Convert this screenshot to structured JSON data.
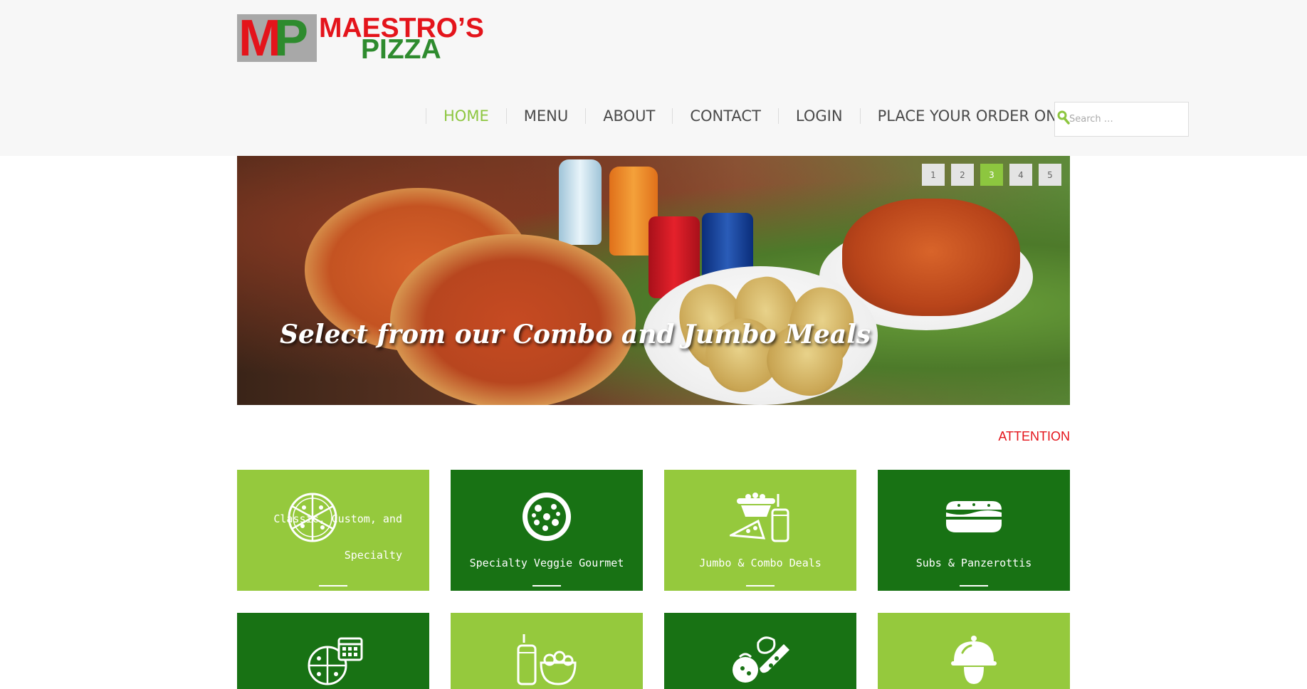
{
  "brand": {
    "logo_mark_m": "M",
    "logo_mark_p": "P",
    "logo_line1": "MAESTRO’S",
    "logo_line2": "PIZZA",
    "red": "#e4141b",
    "green": "#2e8b2e"
  },
  "nav": {
    "items": [
      {
        "label": "HOME",
        "active": true
      },
      {
        "label": "MENU",
        "active": false
      },
      {
        "label": "ABOUT",
        "active": false
      },
      {
        "label": "CONTACT",
        "active": false
      },
      {
        "label": "LOGIN",
        "active": false
      },
      {
        "label": "PLACE YOUR ORDER ONLINE",
        "active": false
      }
    ],
    "active_color": "#8dc63f"
  },
  "search": {
    "placeholder": "Search …",
    "icon": "search-icon"
  },
  "banner": {
    "caption": "Select from our Combo and Jumbo Meals",
    "slides": [
      "1",
      "2",
      "3",
      "4",
      "5"
    ],
    "active_slide": "3"
  },
  "attention": {
    "label": "ATTENTION"
  },
  "categories": [
    {
      "label": "Classic, Custom, and Specialty",
      "icon": "pizza-slices-icon",
      "style": "light"
    },
    {
      "label": "Specialty Veggie Gourmet",
      "icon": "veggie-pizza-icon",
      "style": "dark"
    },
    {
      "label": "Jumbo & Combo Deals",
      "icon": "combo-meal-icon",
      "style": "light"
    },
    {
      "label": "Subs & Panzerottis",
      "icon": "sub-sandwich-icon",
      "style": "dark"
    },
    {
      "label": "",
      "icon": "pizza-calendar-icon",
      "style": "dark"
    },
    {
      "label": "",
      "icon": "drink-salad-icon",
      "style": "light"
    },
    {
      "label": "",
      "icon": "ingredients-icon",
      "style": "dark"
    },
    {
      "label": "",
      "icon": "catering-cloche-icon",
      "style": "light"
    }
  ]
}
